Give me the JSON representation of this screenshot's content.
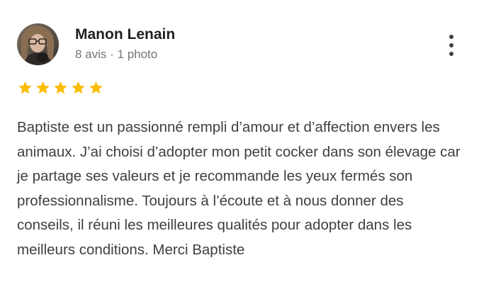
{
  "review": {
    "author_name": "Manon Lenain",
    "author_meta": "8 avis · 1 photo",
    "rating": 5,
    "rating_max": 5,
    "star_color": "#fbbc04",
    "text": "Baptiste est un passionné rempli d’amour et d’affection envers les animaux. J’ai choisi d’adopter mon petit cocker dans son élevage car je partage ses valeurs et je recommande les yeux fermés son professionnalisme. Toujours à l’écoute et à nous donner des conseils, il réuni les meilleures qualités pour adopter dans les meilleurs conditions. Merci Baptiste"
  },
  "icons": {
    "menu": "more-vertical-icon",
    "star": "star-icon",
    "avatar": "user-avatar"
  }
}
